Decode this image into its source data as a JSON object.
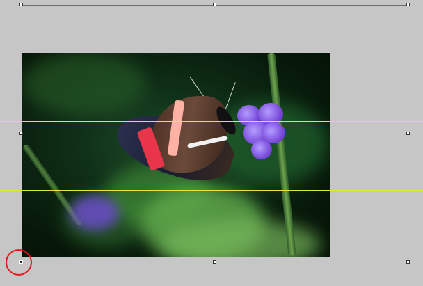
{
  "canvas": {
    "background": "#c6c6c6"
  },
  "photo": {
    "subject": "butterfly-on-purple-flower",
    "colors": {
      "foliage": "#1c4a25",
      "flower": "#7b4ddb",
      "wing_red": "#e8354a",
      "wing_pink": "#ffb1a3"
    }
  },
  "transform": {
    "guide_color": "#e6e63a",
    "highlight_color": "#e01b1b",
    "handle_icon": "square-handle-icon",
    "reference_point_icon": "reference-point-icon"
  }
}
